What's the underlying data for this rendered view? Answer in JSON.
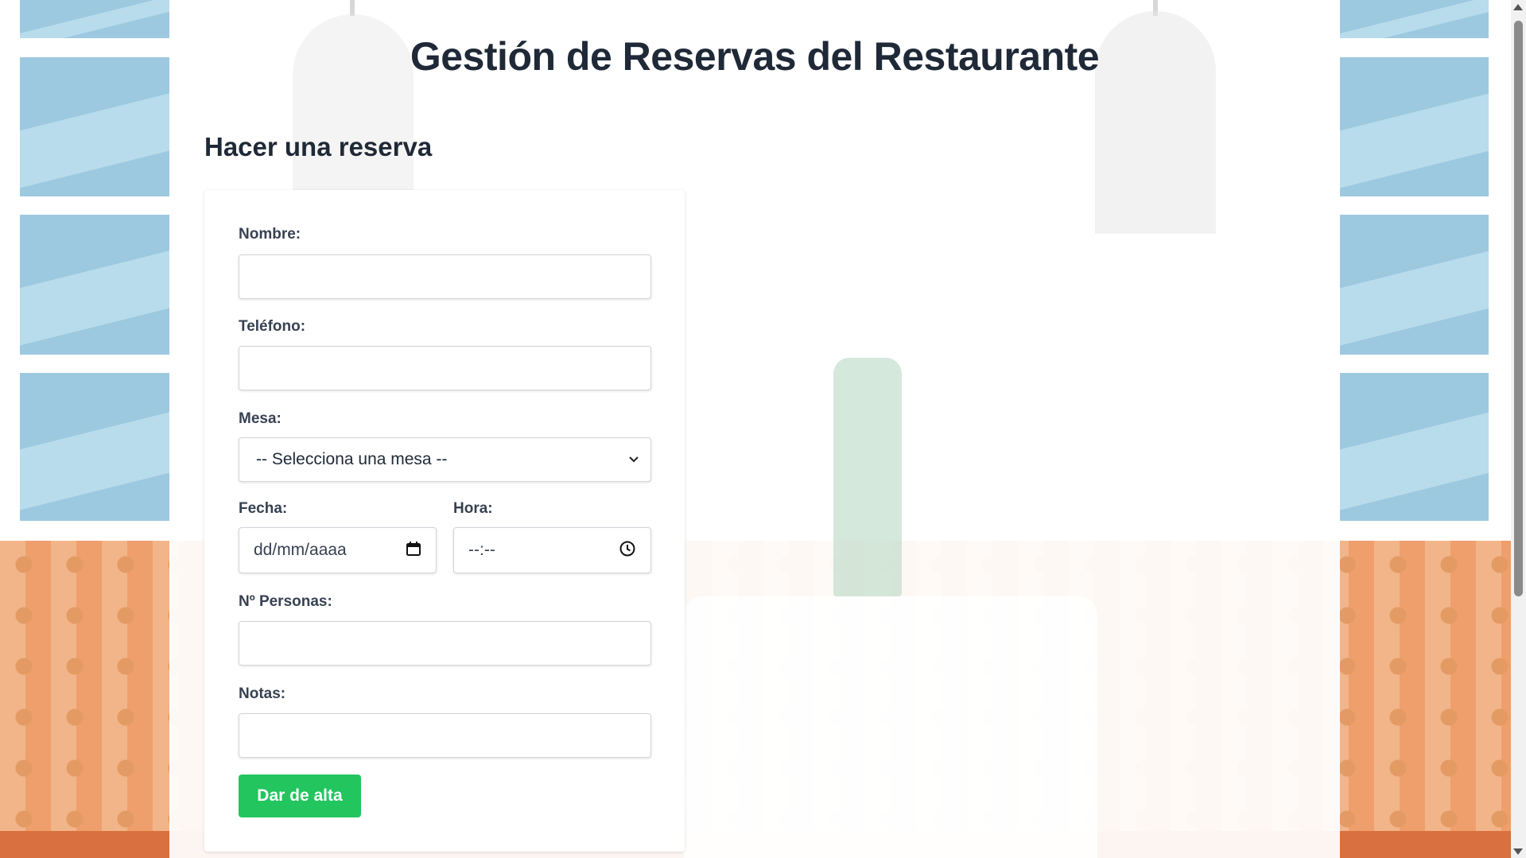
{
  "header": {
    "title": "Gestión de Reservas del Restaurante"
  },
  "reservation": {
    "section_title": "Hacer una reserva",
    "fields": {
      "nombre": {
        "label": "Nombre:",
        "value": ""
      },
      "telefono": {
        "label": "Teléfono:",
        "value": ""
      },
      "mesa": {
        "label": "Mesa:",
        "selected": "-- Selecciona una mesa --"
      },
      "fecha": {
        "label": "Fecha:",
        "placeholder": "dd/mm/aaaa"
      },
      "hora": {
        "label": "Hora:",
        "placeholder": "--:--"
      },
      "personas": {
        "label": "Nº Personas:",
        "value": ""
      },
      "notas": {
        "label": "Notas:",
        "value": ""
      }
    },
    "submit_label": "Dar de alta"
  },
  "icons": {
    "select_arrow": "chevron-down-icon",
    "date_picker": "calendar-icon",
    "time_picker": "clock-icon"
  },
  "colors": {
    "primary_button": "#22c55e",
    "heading_text": "#1f2937"
  }
}
